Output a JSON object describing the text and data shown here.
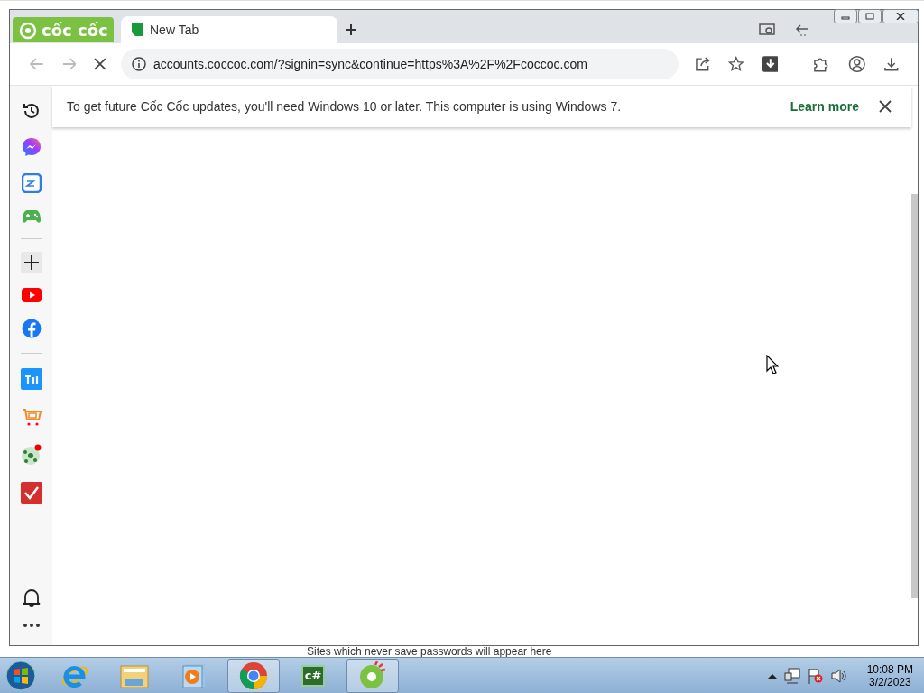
{
  "browser": {
    "logo": "cốc cốc",
    "tabs": [
      {
        "title": "New Tab",
        "selected": true
      }
    ],
    "toolbar": {
      "loading": true,
      "address": "accounts.coccoc.com/?signin=sync&continue=https%3A%2F%2Fcoccoc.com"
    },
    "infobar": {
      "message": "To get future Cốc Cốc updates, you'll need Windows 10 or later. This computer is using Windows 7.",
      "link": "Learn more"
    }
  },
  "background_window": {
    "text": "Sites which never save passwords will appear here"
  },
  "taskbar": {
    "apps": [
      {
        "kind": "ie",
        "running": false
      },
      {
        "kind": "explorer",
        "running": false
      },
      {
        "kind": "media",
        "running": false
      },
      {
        "kind": "chrome",
        "running": true
      },
      {
        "kind": "csharp",
        "running": false,
        "label": "c#"
      },
      {
        "kind": "coccoc",
        "running": true
      }
    ],
    "clock": {
      "time": "10:08 PM",
      "date": "3/2/2023"
    }
  }
}
